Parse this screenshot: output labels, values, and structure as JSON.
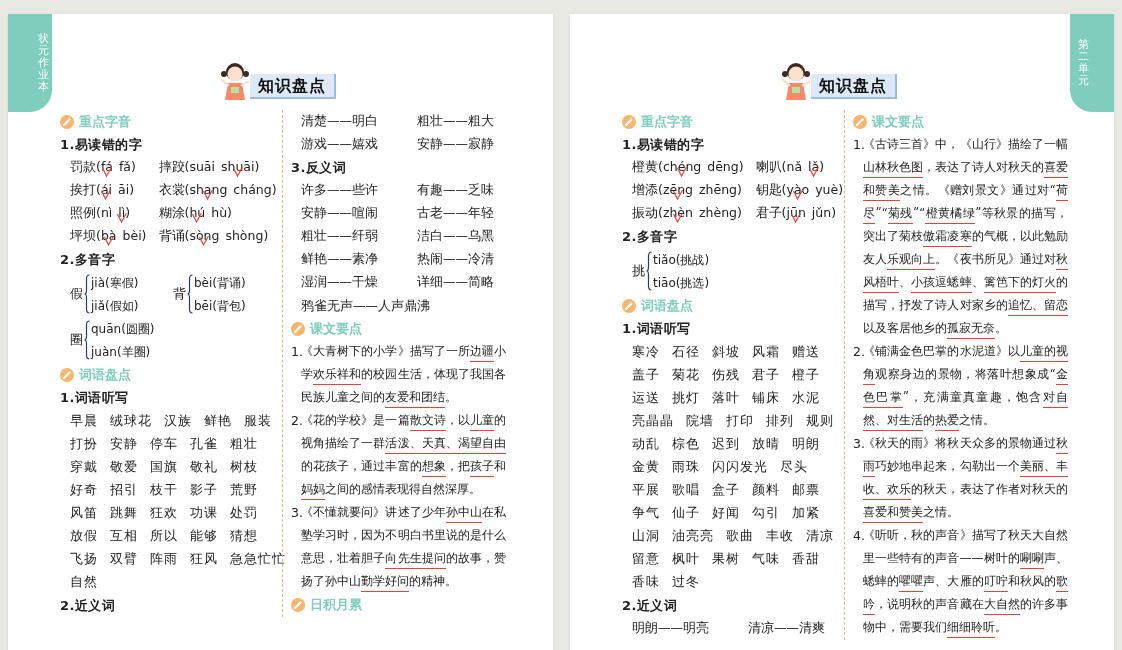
{
  "pages": [
    {
      "side_tab": "状元作业本",
      "title": "知识盘点",
      "columns": [
        [
          {
            "kind": "heading",
            "text": "重点字音"
          },
          {
            "kind": "sub",
            "text": "1.易读错的字"
          },
          {
            "kind": "pinyin",
            "items": [
              {
                "word": "罚款(",
                "options": [
                  {
                    "pinyin": "fá",
                    "selected": true
                  },
                  {
                    "pinyin": "fǎ",
                    "selected": false
                  }
                ],
                "close": ")"
              },
              {
                "word": "摔跤(",
                "options": [
                  {
                    "pinyin": "suāi",
                    "selected": false
                  },
                  {
                    "pinyin": "shuāi",
                    "selected": true
                  }
                ],
                "close": ")"
              },
              {
                "word": "挨打(",
                "options": [
                  {
                    "pinyin": "ái",
                    "selected": true
                  },
                  {
                    "pinyin": "āi",
                    "selected": false
                  }
                ],
                "close": ")"
              },
              {
                "word": "衣裳(",
                "options": [
                  {
                    "pinyin": "shang",
                    "selected": true
                  },
                  {
                    "pinyin": "cháng",
                    "selected": false
                  }
                ],
                "close": ")"
              },
              {
                "word": "照例(",
                "options": [
                  {
                    "pinyin": "nì",
                    "selected": false
                  },
                  {
                    "pinyin": "lì",
                    "selected": true
                  }
                ],
                "close": ")"
              },
              {
                "word": "糊涂(",
                "options": [
                  {
                    "pinyin": "hú",
                    "selected": true
                  },
                  {
                    "pinyin": "hù",
                    "selected": false
                  }
                ],
                "close": ")"
              },
              {
                "word": "坪坝(",
                "options": [
                  {
                    "pinyin": "bà",
                    "selected": true
                  },
                  {
                    "pinyin": "bèi",
                    "selected": false
                  }
                ],
                "close": ")"
              },
              {
                "word": "背诵(",
                "options": [
                  {
                    "pinyin": "sòng",
                    "selected": true
                  },
                  {
                    "pinyin": "shòng",
                    "selected": false
                  }
                ],
                "close": ")"
              }
            ]
          },
          {
            "kind": "sub",
            "text": "2.多音字"
          },
          {
            "kind": "poly",
            "rows": [
              [
                {
                  "char": "假",
                  "readings": [
                    "jià(寒假)",
                    "jiǎ(假如)"
                  ]
                },
                {
                  "char": "背",
                  "readings": [
                    "bèi(背诵)",
                    "bēi(背包)"
                  ]
                }
              ],
              [
                {
                  "char": "圈",
                  "readings": [
                    "quān(圆圈)",
                    "juàn(羊圈)"
                  ]
                }
              ]
            ]
          },
          {
            "kind": "heading",
            "text": "词语盘点"
          },
          {
            "kind": "sub",
            "text": "1.词语听写"
          },
          {
            "kind": "words",
            "rows": [
              [
                "早晨",
                "绒球花",
                "汉族",
                "鲜艳",
                "服装"
              ],
              [
                "打扮",
                "安静",
                "停车",
                "孔雀",
                "粗壮"
              ],
              [
                "穿戴",
                "敬爱",
                "国旗",
                "敬礼",
                "树枝"
              ],
              [
                "好奇",
                "招引",
                "枝干",
                "影子",
                "荒野"
              ],
              [
                "风笛",
                "跳舞",
                "狂欢",
                "功课",
                "处罚"
              ],
              [
                "放假",
                "互相",
                "所以",
                "能够",
                "猜想"
              ],
              [
                "飞扬",
                "双臂",
                "阵雨",
                "狂风",
                "急急忙忙"
              ],
              [
                "自然"
              ]
            ]
          },
          {
            "kind": "sub",
            "text": "2.近义词"
          }
        ],
        [
          {
            "kind": "pairs",
            "items": [
              "清楚——明白",
              "粗壮——粗大",
              "游戏——嬉戏",
              "安静——寂静"
            ]
          },
          {
            "kind": "sub",
            "text": "3.反义词"
          },
          {
            "kind": "pairs",
            "items": [
              "许多——些许",
              "有趣——乏味",
              "安静——喧闹",
              "古老——年轻",
              "粗壮——纤弱",
              "洁白——乌黑",
              "鲜艳——素净",
              "热闹——冷清",
              "湿润——干燥",
              "详细——简略"
            ]
          },
          {
            "kind": "line",
            "text": "鸦雀无声——人声鼎沸"
          },
          {
            "kind": "heading",
            "text": "课文要点"
          },
          {
            "kind": "paras",
            "items": [
              {
                "number": "1.",
                "segments": [
                  {
                    "text": "《大青树下的小学》描写了一所",
                    "underlined": false
                  },
                  {
                    "text": "边疆",
                    "underlined": true
                  },
                  {
                    "text": "小学",
                    "underlined": false
                  },
                  {
                    "text": "欢乐祥和",
                    "underlined": true
                  },
                  {
                    "text": "的校园生活，体现了我国各民族儿童之间的",
                    "underlined": false
                  },
                  {
                    "text": "友爱和团结",
                    "underlined": true
                  },
                  {
                    "text": "。",
                    "underlined": false
                  }
                ]
              },
              {
                "number": "2.",
                "segments": [
                  {
                    "text": "《花的学校》是一篇",
                    "underlined": false
                  },
                  {
                    "text": "散文诗",
                    "underlined": true
                  },
                  {
                    "text": "，以",
                    "underlined": false
                  },
                  {
                    "text": "儿童",
                    "underlined": true
                  },
                  {
                    "text": "的视角描绘了一群",
                    "underlined": false
                  },
                  {
                    "text": "活泼、天真、渴望自由",
                    "underlined": true
                  },
                  {
                    "text": "的花孩子，通过丰富的",
                    "underlined": false
                  },
                  {
                    "text": "想象",
                    "underlined": true
                  },
                  {
                    "text": "，把",
                    "underlined": false
                  },
                  {
                    "text": "孩子",
                    "underlined": true
                  },
                  {
                    "text": "和",
                    "underlined": false
                  },
                  {
                    "text": "妈妈",
                    "underlined": true
                  },
                  {
                    "text": "之间的感情表现得自然深厚。",
                    "underlined": false
                  }
                ]
              },
              {
                "number": "3.",
                "segments": [
                  {
                    "text": "《不懂就要问》讲述了少年",
                    "underlined": false
                  },
                  {
                    "text": "孙中山",
                    "underlined": true
                  },
                  {
                    "text": "在私塾学习时，因为不明白书里说的是什么意思，壮着胆子",
                    "underlined": false
                  },
                  {
                    "text": "向先生提问",
                    "underlined": true
                  },
                  {
                    "text": "的故事，赞扬了孙中山",
                    "underlined": false
                  },
                  {
                    "text": "勤学好问",
                    "underlined": true
                  },
                  {
                    "text": "的精神。",
                    "underlined": false
                  }
                ]
              }
            ]
          },
          {
            "kind": "heading",
            "text": "日积月累"
          }
        ]
      ]
    },
    {
      "side_tab": "第二单元",
      "title": "知识盘点",
      "columns": [
        [
          {
            "kind": "heading",
            "text": "重点字音"
          },
          {
            "kind": "sub",
            "text": "1.易读错的字"
          },
          {
            "kind": "pinyin",
            "items": [
              {
                "word": "橙黄(",
                "options": [
                  {
                    "pinyin": "chéng",
                    "selected": true
                  },
                  {
                    "pinyin": "dēng",
                    "selected": false
                  }
                ],
                "close": ")"
              },
              {
                "word": "喇叭(",
                "options": [
                  {
                    "pinyin": "nǎ",
                    "selected": false
                  },
                  {
                    "pinyin": "lǎ",
                    "selected": true
                  }
                ],
                "close": ")"
              },
              {
                "word": "增添(",
                "options": [
                  {
                    "pinyin": "zēng",
                    "selected": true
                  },
                  {
                    "pinyin": "zhēng",
                    "selected": false
                  }
                ],
                "close": ")"
              },
              {
                "word": "钥匙(",
                "options": [
                  {
                    "pinyin": "yào",
                    "selected": true
                  },
                  {
                    "pinyin": "yuè",
                    "selected": false
                  }
                ],
                "close": ")"
              },
              {
                "word": "振动(",
                "options": [
                  {
                    "pinyin": "zhèn",
                    "selected": true
                  },
                  {
                    "pinyin": "zhèng",
                    "selected": false
                  }
                ],
                "close": ")"
              },
              {
                "word": "君子(",
                "options": [
                  {
                    "pinyin": "jūn",
                    "selected": true
                  },
                  {
                    "pinyin": "jǔn",
                    "selected": false
                  }
                ],
                "close": ")"
              }
            ]
          },
          {
            "kind": "sub",
            "text": "2.多音字"
          },
          {
            "kind": "poly",
            "rows": [
              [
                {
                  "char": "挑",
                  "readings": [
                    "tiǎo(挑战)",
                    "tiāo(挑选)"
                  ]
                }
              ]
            ]
          },
          {
            "kind": "heading",
            "text": "词语盘点"
          },
          {
            "kind": "sub",
            "text": "1.词语听写"
          },
          {
            "kind": "words",
            "rows": [
              [
                "寒冷",
                "石径",
                "斜坡",
                "风霜",
                "赠送"
              ],
              [
                "盖子",
                "菊花",
                "伤残",
                "君子",
                "橙子"
              ],
              [
                "运送",
                "挑灯",
                "落叶",
                "铺床",
                "水泥"
              ],
              [
                "亮晶晶",
                "院墙",
                "打印",
                "排列",
                "规则"
              ],
              [
                "动乱",
                "棕色",
                "迟到",
                "放晴",
                "明朗"
              ],
              [
                "金黄",
                "雨珠",
                "闪闪发光",
                "尽头"
              ],
              [
                "平展",
                "歌唱",
                "盒子",
                "颜料",
                "邮票"
              ],
              [
                "争气",
                "仙子",
                "好闻",
                "勾引",
                "加紧"
              ],
              [
                "山洞",
                "油亮亮",
                "歌曲",
                "丰收",
                "清凉"
              ],
              [
                "留意",
                "枫叶",
                "果树",
                "气味",
                "香甜"
              ],
              [
                "香味",
                "过冬"
              ]
            ]
          },
          {
            "kind": "sub",
            "text": "2.近义词"
          },
          {
            "kind": "pairs",
            "items": [
              "明朗——明亮",
              "清凉——清爽"
            ]
          }
        ],
        [
          {
            "kind": "heading",
            "text": "课文要点"
          },
          {
            "kind": "paras",
            "items": [
              {
                "number": "1.",
                "segments": [
                  {
                    "text": "《古诗三首》中，《山行》描绘了一幅",
                    "underlined": false
                  },
                  {
                    "text": "山林秋色图",
                    "underlined": true
                  },
                  {
                    "text": "，表达了诗人对秋天的",
                    "underlined": false
                  },
                  {
                    "text": "喜爱和赞美",
                    "underlined": true
                  },
                  {
                    "text": "之情。《赠刘景文》通过对“",
                    "underlined": false
                  },
                  {
                    "text": "荷尽",
                    "underlined": true
                  },
                  {
                    "text": "”“",
                    "underlined": false
                  },
                  {
                    "text": "菊残",
                    "underlined": true
                  },
                  {
                    "text": "”“",
                    "underlined": false
                  },
                  {
                    "text": "橙黄橘绿",
                    "underlined": true
                  },
                  {
                    "text": "”等秋景的描写，突出了菊枝",
                    "underlined": false
                  },
                  {
                    "text": "傲霜凌寒",
                    "underlined": true
                  },
                  {
                    "text": "的气概，以此勉励友人",
                    "underlined": false
                  },
                  {
                    "text": "乐观向上",
                    "underlined": true
                  },
                  {
                    "text": "。《夜书所见》通过对",
                    "underlined": false
                  },
                  {
                    "text": "秋风梧叶",
                    "underlined": true
                  },
                  {
                    "text": "、",
                    "underlined": false
                  },
                  {
                    "text": "小孩逗蟋蟀",
                    "underlined": true
                  },
                  {
                    "text": "、",
                    "underlined": false
                  },
                  {
                    "text": "篱笆下的灯火",
                    "underlined": true
                  },
                  {
                    "text": "的描写，抒发了诗人对家乡的",
                    "underlined": false
                  },
                  {
                    "text": "追忆、留恋",
                    "underlined": true
                  },
                  {
                    "text": "以及客居他乡的",
                    "underlined": false
                  },
                  {
                    "text": "孤寂无奈",
                    "underlined": true
                  },
                  {
                    "text": "。",
                    "underlined": false
                  }
                ]
              },
              {
                "number": "2.",
                "segments": [
                  {
                    "text": "《铺满金色巴掌的水泥道》以",
                    "underlined": false
                  },
                  {
                    "text": "儿童的视角",
                    "underlined": true
                  },
                  {
                    "text": "观察身边的景物，将落叶想象成“",
                    "underlined": false
                  },
                  {
                    "text": "金色巴掌",
                    "underlined": true
                  },
                  {
                    "text": "”，充满童真童趣，饱含",
                    "underlined": false
                  },
                  {
                    "text": "对自然、对生活",
                    "underlined": true
                  },
                  {
                    "text": "的",
                    "underlined": false
                  },
                  {
                    "text": "热爱",
                    "underlined": true
                  },
                  {
                    "text": "之情。",
                    "underlined": false
                  }
                ]
              },
              {
                "number": "3.",
                "segments": [
                  {
                    "text": "《秋天的雨》将秋天众多的景物通过",
                    "underlined": false
                  },
                  {
                    "text": "秋雨",
                    "underlined": true
                  },
                  {
                    "text": "巧妙地串起来，勾勒出一个",
                    "underlined": false
                  },
                  {
                    "text": "美丽、丰收、欢乐",
                    "underlined": true
                  },
                  {
                    "text": "的秋天，表达了作者对秋天的",
                    "underlined": false
                  },
                  {
                    "text": "喜爱和赞美",
                    "underlined": true
                  },
                  {
                    "text": "之情。",
                    "underlined": false
                  }
                ]
              },
              {
                "number": "4.",
                "segments": [
                  {
                    "text": "《听听，秋的声音》描写了秋天大自然里一些特有的声音——树叶的",
                    "underlined": false
                  },
                  {
                    "text": "唰唰",
                    "underlined": true
                  },
                  {
                    "text": "声、蟋蟀的",
                    "underlined": false
                  },
                  {
                    "text": "㘗㘗",
                    "underlined": true
                  },
                  {
                    "text": "声、大雁的",
                    "underlined": false
                  },
                  {
                    "text": "叮咛",
                    "underlined": true
                  },
                  {
                    "text": "和秋风的",
                    "underlined": false
                  },
                  {
                    "text": "歌吟",
                    "underlined": true
                  },
                  {
                    "text": "，说明秋的声音藏在",
                    "underlined": false
                  },
                  {
                    "text": "大自然",
                    "underlined": true
                  },
                  {
                    "text": "的许多事物中，需要我们",
                    "underlined": false
                  },
                  {
                    "text": "细细聆听",
                    "underlined": true
                  },
                  {
                    "text": "。",
                    "underlined": false
                  }
                ]
              }
            ]
          }
        ]
      ]
    }
  ]
}
